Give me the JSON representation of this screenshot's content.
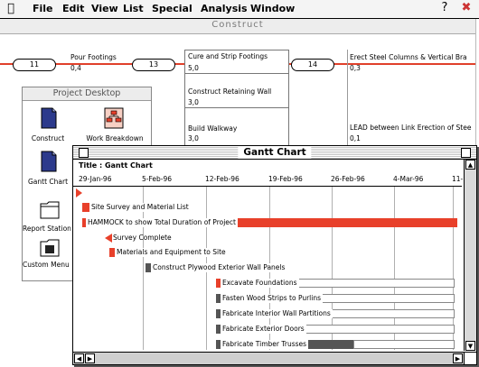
{
  "menubar": {
    "items": [
      "File",
      "Edit",
      "View",
      "List",
      "Special",
      "Analysis",
      "Window"
    ],
    "help_icon": "help-balloon-icon",
    "app_icon": "application-icon"
  },
  "construct_window": {
    "title": "Construct",
    "nodes": [
      {
        "id": "11",
        "name": "Pour Footings",
        "value": "0,4"
      },
      {
        "id": "13",
        "name": "Cure and Strip Footings",
        "value": "5,0"
      },
      {
        "id": "14",
        "name": "Erect Steel Columns & Vertical Bra",
        "value": "0,3"
      }
    ],
    "extra_tasks": [
      {
        "name": "Construct Retaining Wall",
        "value": "3,0"
      },
      {
        "name": "Build Walkway",
        "value": "3,0"
      },
      {
        "name": "LEAD between Link Erection of Stee",
        "value": "0,1"
      }
    ]
  },
  "project_desktop": {
    "title": "Project Desktop",
    "items": [
      {
        "label": "Construct",
        "icon": "network-document-icon"
      },
      {
        "label": "Work Breakdown",
        "icon": "work-breakdown-icon"
      },
      {
        "label": "Gantt Chart",
        "icon": "gantt-document-icon"
      },
      {
        "label": "Report Station",
        "icon": "folder-icon"
      },
      {
        "label": "Custom Menu",
        "icon": "menu-folder-icon"
      }
    ]
  },
  "gantt_window": {
    "title": "Gantt Chart",
    "subtitle": "Title : Gantt Chart",
    "dates": [
      "29-Jan-96",
      "5-Feb-96",
      "12-Feb-96",
      "19-Feb-96",
      "26-Feb-96",
      "4-Mar-96",
      "11-"
    ],
    "colors": {
      "critical": "#e8402a",
      "noncritical": "#555555"
    },
    "tasks": [
      {
        "label": "Site Survey and Material List",
        "type": "red"
      },
      {
        "label": "HAMMOCK to show Total Duration of Project",
        "type": "red"
      },
      {
        "label": "Survey Complete",
        "type": "milestone"
      },
      {
        "label": "Materials and Equipment to Site",
        "type": "red"
      },
      {
        "label": "Construct Plywood Exterior Wall Panels",
        "type": "gray"
      },
      {
        "label": "Excavate Foundations",
        "type": "red"
      },
      {
        "label": "Fasten Wood Strips to Purlins",
        "type": "gray"
      },
      {
        "label": "Fabricate Interior Wall Partitions",
        "type": "gray"
      },
      {
        "label": "Fabricate Exterior Doors",
        "type": "gray"
      },
      {
        "label": "Fabricate Timber Trusses",
        "type": "gray"
      }
    ]
  }
}
